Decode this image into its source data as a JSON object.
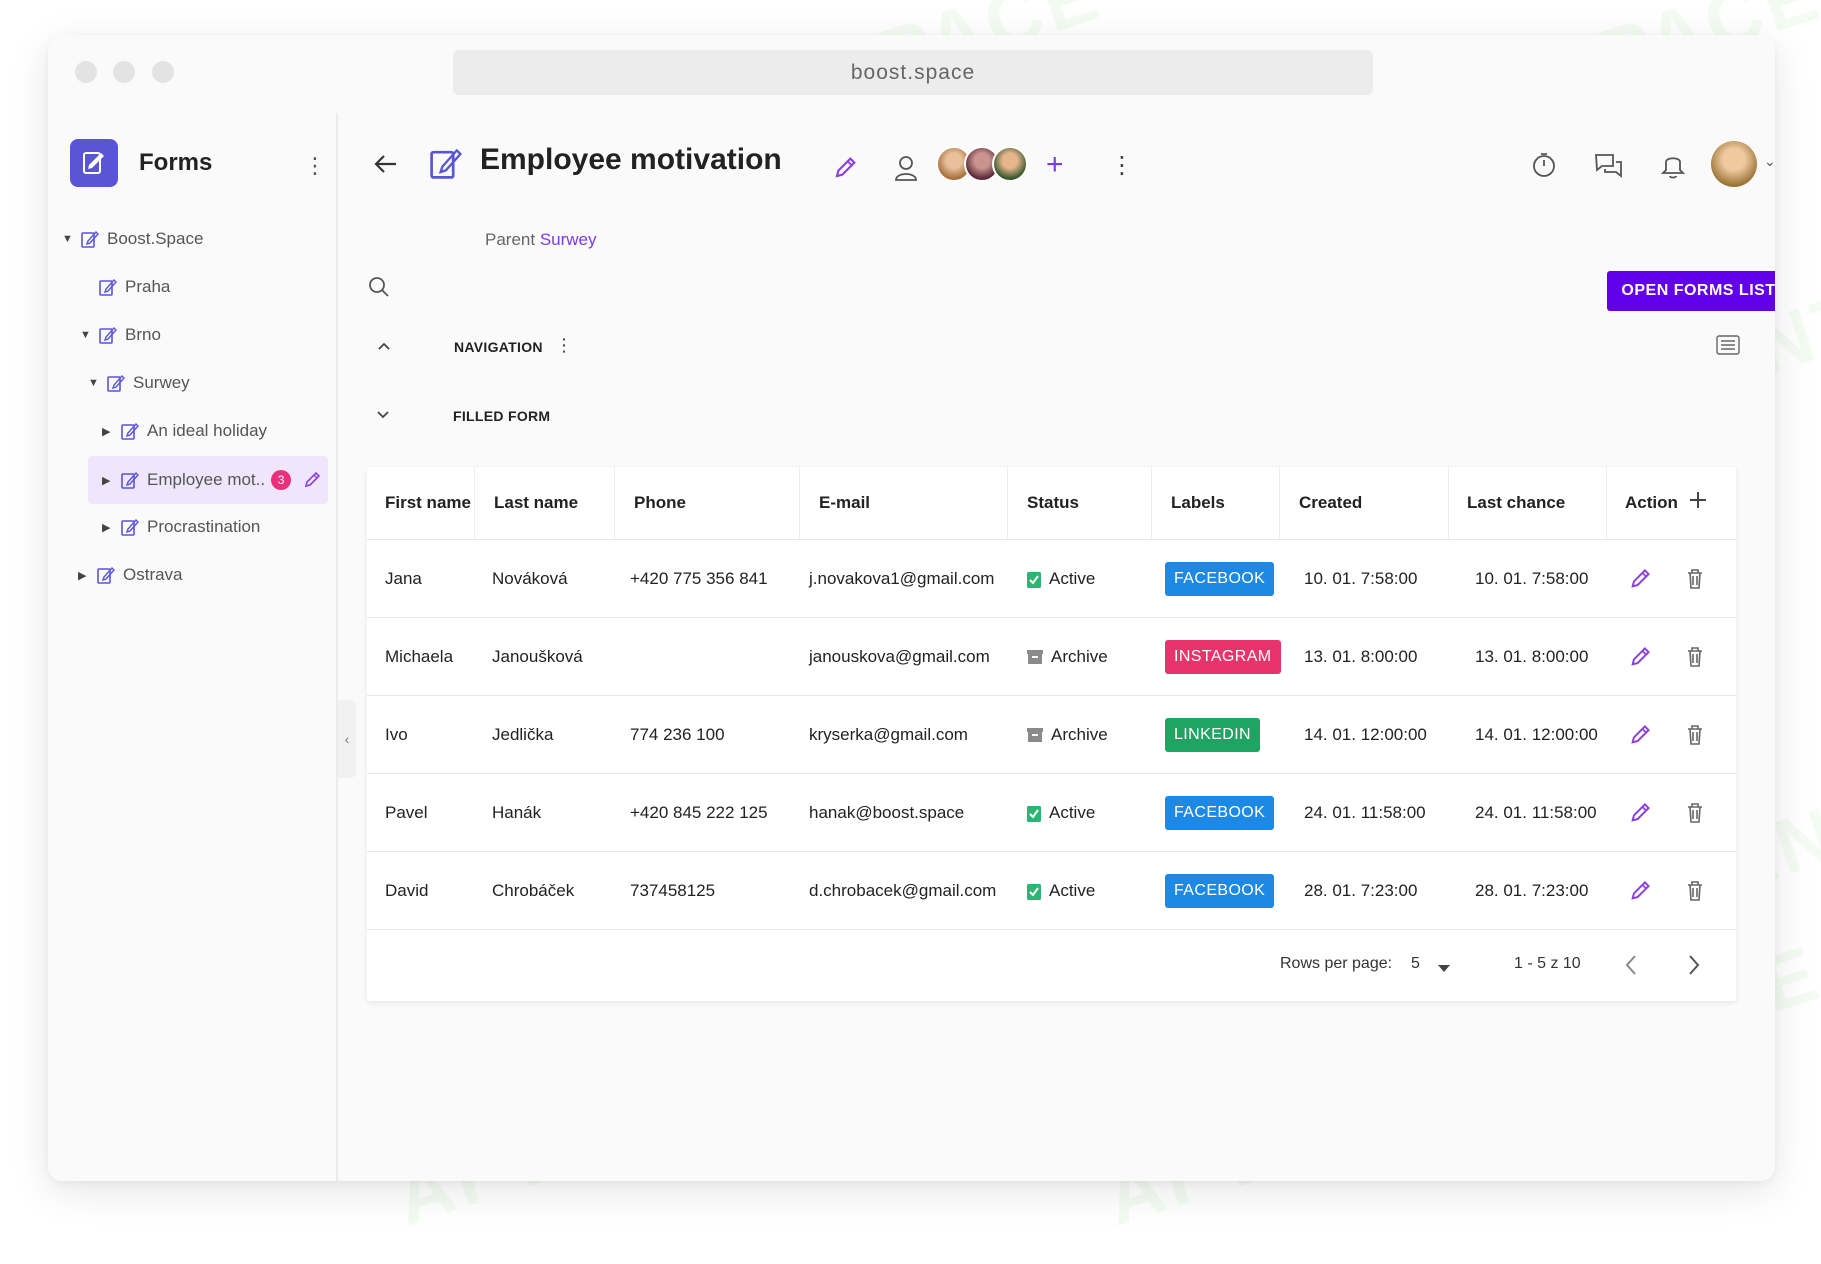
{
  "browser": {
    "url": "boost.space"
  },
  "sidebar": {
    "app_name": "Forms",
    "items": [
      {
        "label": "Boost.Space",
        "caret": "▼"
      },
      {
        "label": "Praha",
        "caret": ""
      },
      {
        "label": "Brno",
        "caret": "▼"
      },
      {
        "label": "Surwey",
        "caret": "▼"
      },
      {
        "label": "An ideal holiday",
        "caret": "▶"
      },
      {
        "label": "Employee mot..",
        "caret": "▶",
        "badge": "3"
      },
      {
        "label": "Procrastination",
        "caret": "▶"
      },
      {
        "label": "Ostrava",
        "caret": "▶"
      }
    ]
  },
  "header": {
    "title": "Employee motivation",
    "parent_label": "Parent",
    "parent_link": "Surwey",
    "open_forms_button": "OPEN FORMS LIST"
  },
  "sections": {
    "navigation": "NAVIGATION",
    "filled_form": "FILLED FORM"
  },
  "table": {
    "columns": [
      "First name",
      "Last name",
      "Phone",
      "E-mail",
      "Status",
      "Labels",
      "Created",
      "Last chance",
      "Action"
    ],
    "rows": [
      {
        "first": "Jana",
        "last": "Nováková",
        "phone": "+420 775 356 841",
        "email": "j.novakova1@gmail.com",
        "status": "Active",
        "label": "FACEBOOK",
        "created": "10. 01.   7:58:00",
        "last_chance": "10. 01.   7:58:00"
      },
      {
        "first": "Michaela",
        "last": "Janoušková",
        "phone": "",
        "email": "janouskova@gmail.com",
        "status": "Archive",
        "label": "INSTAGRAM",
        "created": "13. 01.   8:00:00",
        "last_chance": "13. 01.   8:00:00"
      },
      {
        "first": "Ivo",
        "last": "Jedlička",
        "phone": "774 236 100",
        "email": "kryserka@gmail.com",
        "status": "Archive",
        "label": "LINKEDIN",
        "created": "14. 01.   12:00:00",
        "last_chance": "14. 01.   12:00:00"
      },
      {
        "first": "Pavel",
        "last": "Hanák",
        "phone": "+420 845 222 125",
        "email": "hanak@boost.space",
        "status": "Active",
        "label": "FACEBOOK",
        "created": "24. 01.   11:58:00",
        "last_chance": "24. 01.   11:58:00"
      },
      {
        "first": "David",
        "last": "Chrobáček",
        "phone": "737458125",
        "email": "d.chrobacek@gmail.com",
        "status": "Active",
        "label": "FACEBOOK",
        "created": "28. 01.   7:23:00",
        "last_chance": "28. 01.   7:23:00"
      }
    ],
    "label_colors": {
      "FACEBOOK": "#1e88e5",
      "INSTAGRAM": "#e8336d",
      "LINKEDIN": "#1fa463"
    },
    "status_colors": {
      "Active": "#2bb673",
      "Archive": "#8a8a8a"
    },
    "footer": {
      "rows_per_page_label": "Rows per page:",
      "rows_per_page_value": "5",
      "range": "1 - 5 z 10"
    }
  },
  "colors": {
    "accent": "#6200ea",
    "link": "#7c3aed",
    "sidebar_selected": "#efe6fb",
    "badge": "#e8317a"
  },
  "watermark": "AI TALENT SPACE"
}
